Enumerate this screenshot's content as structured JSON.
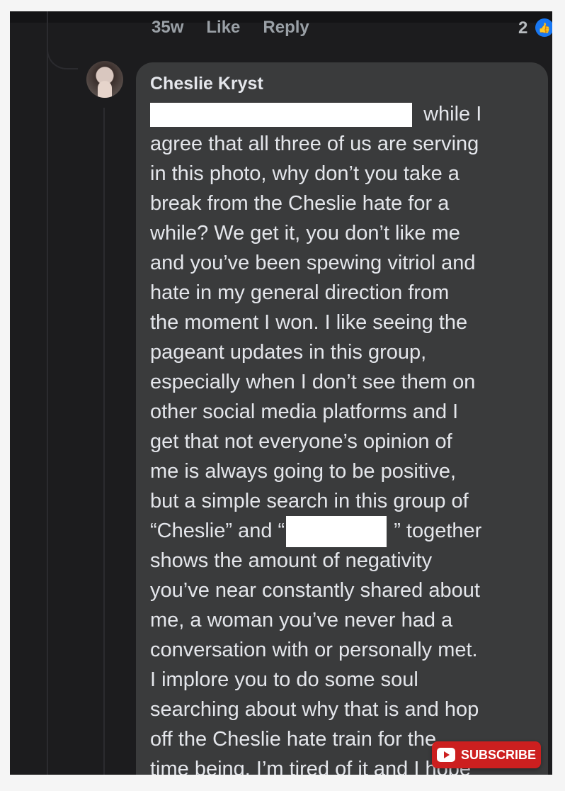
{
  "header": {
    "time": "35w",
    "like": "Like",
    "reply": "Reply",
    "reaction_count": "2",
    "reaction_icon": "like-icon",
    "reaction_color": "#1877f2"
  },
  "comment": {
    "author": "Cheslie Kryst",
    "lines": [
      "while I",
      "agree that all three of us are serving",
      "in this photo, why don’t you take a",
      "break from the Cheslie hate for a",
      "while? We get it, you don’t like me",
      "and you’ve been spewing vitriol and",
      "hate in my general direction from",
      "the moment I won. I like seeing the",
      "pageant updates in this group,",
      "especially when I don’t see them on",
      "other social media platforms and I",
      "get that not everyone’s opinion of",
      "me is always going to be positive,",
      "but a simple search in this group of",
      "“Cheslie” and “",
      "” together",
      "shows the amount of negativity",
      "you’ve near constantly shared about",
      "me, a woman you’ve never had a",
      "conversation with or personally met.",
      "I implore you to do some soul",
      "searching about why that is and hop",
      "off the Cheslie hate train for the",
      "time being. I’m tired of it and I hope"
    ]
  },
  "overlay": {
    "subscribe_label": "SUBSCRIBE",
    "icon": "play-icon",
    "color": "#cc1f1f"
  },
  "colors": {
    "background": "#1c1c1e",
    "bubble": "#3a3b3c",
    "text": "#e4e6eb",
    "muted": "#9aa0a6"
  }
}
